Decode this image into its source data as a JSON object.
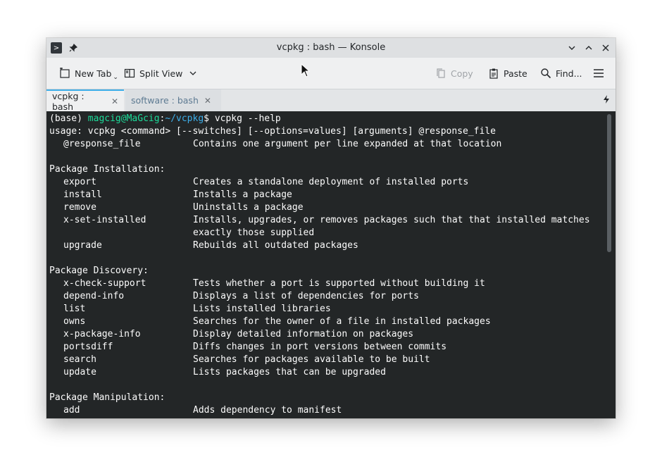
{
  "window": {
    "title": "vcpkg : bash — Konsole"
  },
  "toolbar": {
    "new_tab": "New Tab",
    "split_view": "Split View",
    "copy": "Copy",
    "paste": "Paste",
    "find": "Find..."
  },
  "tabs": [
    {
      "label": "vcpkg : bash",
      "active": true
    },
    {
      "label": "software : bash",
      "active": false
    }
  ],
  "terminal": {
    "prompt": {
      "env": "(base) ",
      "user_host": "magcig@MaGcig",
      "sep": ":",
      "path": "~/vcpkg",
      "dollar": "$ ",
      "command": "vcpkg --help"
    },
    "usage": "usage: vcpkg <command> [--switches] [--options=values] [arguments] @response_file",
    "response_file": {
      "cmd": "@response_file",
      "desc": "Contains one argument per line expanded at that location"
    },
    "sections": [
      {
        "heading": "Package Installation:",
        "items": [
          {
            "cmd": "export",
            "desc": "Creates a standalone deployment of installed ports"
          },
          {
            "cmd": "install",
            "desc": "Installs a package"
          },
          {
            "cmd": "remove",
            "desc": "Uninstalls a package"
          },
          {
            "cmd": "x-set-installed",
            "desc": "Installs, upgrades, or removes packages such that that installed matches"
          },
          {
            "cmd": "",
            "desc": "exactly those supplied"
          },
          {
            "cmd": "upgrade",
            "desc": "Rebuilds all outdated packages"
          }
        ]
      },
      {
        "heading": "Package Discovery:",
        "items": [
          {
            "cmd": "x-check-support",
            "desc": "Tests whether a port is supported without building it"
          },
          {
            "cmd": "depend-info",
            "desc": "Displays a list of dependencies for ports"
          },
          {
            "cmd": "list",
            "desc": "Lists installed libraries"
          },
          {
            "cmd": "owns",
            "desc": "Searches for the owner of a file in installed packages"
          },
          {
            "cmd": "x-package-info",
            "desc": "Display detailed information on packages"
          },
          {
            "cmd": "portsdiff",
            "desc": "Diffs changes in port versions between commits"
          },
          {
            "cmd": "search",
            "desc": "Searches for packages available to be built"
          },
          {
            "cmd": "update",
            "desc": "Lists packages that can be upgraded"
          }
        ]
      },
      {
        "heading": "Package Manipulation:",
        "items": [
          {
            "cmd": "add",
            "desc": "Adds dependency to manifest"
          }
        ]
      }
    ]
  }
}
